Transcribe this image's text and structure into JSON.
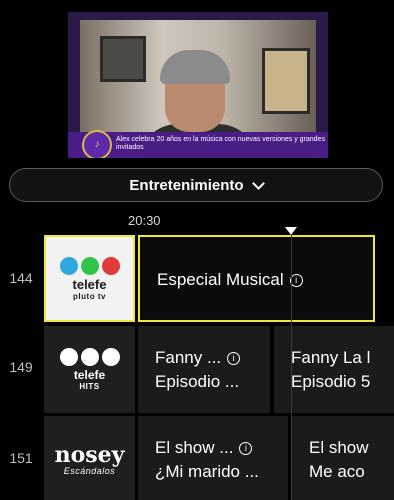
{
  "preview": {
    "caption": "Alex celebra 20 años en la música con nuevas versiones y grandes invitados",
    "badge_icon": "music-badge-icon"
  },
  "category": {
    "label": "Entretenimiento",
    "icon": "chevron-down-icon"
  },
  "timeline": {
    "time": "20:30"
  },
  "channels": [
    {
      "number": "144",
      "logo": {
        "word": "telefe",
        "sub": "pluto tv",
        "dot_colors": [
          "#2fa8e0",
          "#33c24a",
          "#e23a3a"
        ]
      },
      "programs": [
        {
          "title": "Especial Musical",
          "subtitle": ""
        }
      ]
    },
    {
      "number": "149",
      "logo": {
        "word": "telefe",
        "sub": "HITS",
        "dot_colors": [
          "#ffffff",
          "#ffffff",
          "#ffffff"
        ]
      },
      "programs": [
        {
          "title": "Fanny ...",
          "subtitle": "Episodio ..."
        },
        {
          "title": "Fanny La l",
          "subtitle": "Episodio 5"
        }
      ]
    },
    {
      "number": "151",
      "logo": {
        "word": "nosey",
        "sub": "Escándalos"
      },
      "programs": [
        {
          "title": "El show ...",
          "subtitle": "¿Mi marido ..."
        },
        {
          "title": "El show",
          "subtitle": "Me aco"
        }
      ]
    }
  ]
}
